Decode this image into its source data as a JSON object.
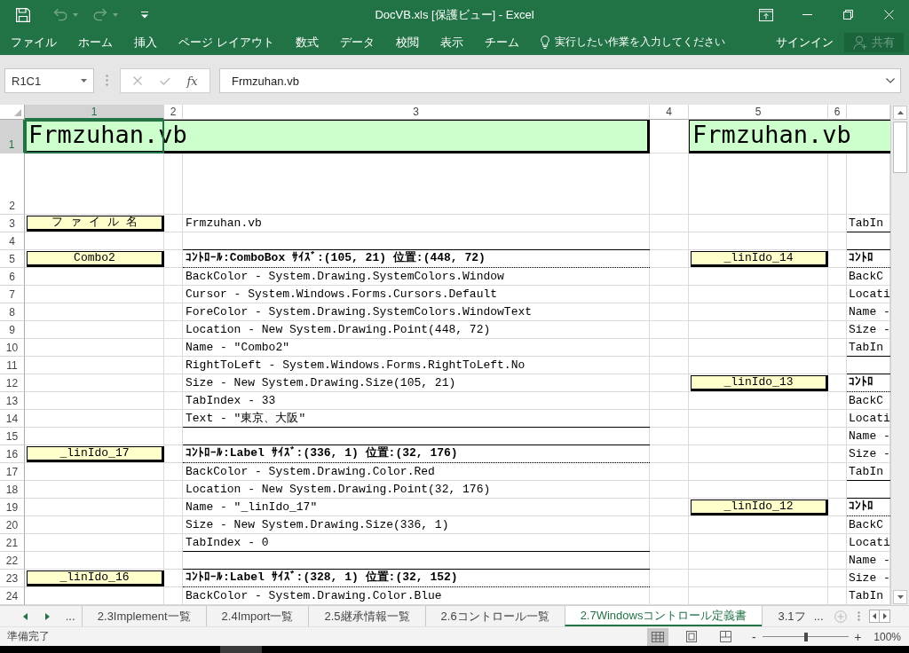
{
  "window": {
    "title": "DocVB.xls [保護ビュー] - Excel"
  },
  "quick_access": [
    {
      "kind": "save",
      "disabled": false
    },
    {
      "kind": "undo",
      "disabled": true
    },
    {
      "kind": "redo",
      "disabled": true
    },
    {
      "kind": "customize",
      "disabled": false
    }
  ],
  "ribbon": {
    "tabs": [
      "ファイル",
      "ホーム",
      "挿入",
      "ページ レイアウト",
      "数式",
      "データ",
      "校閲",
      "表示",
      "チーム"
    ],
    "tell_me": {
      "placeholder": "実行したい作業を入力してください"
    },
    "sign_in": "サインイン",
    "share": {
      "label": "共有",
      "disabled": true
    }
  },
  "formula_bar": {
    "name_box": "R1C1",
    "cancel": {
      "disabled": true
    },
    "enter": {
      "disabled": true
    },
    "function_label": "fx",
    "value": "Frmzuhan.vb"
  },
  "sheet": {
    "columns": [
      {
        "label": "1",
        "selected": true
      },
      {
        "label": "2",
        "selected": false
      },
      {
        "label": "3",
        "selected": false
      },
      {
        "label": "4",
        "selected": false
      },
      {
        "label": "5",
        "selected": false
      },
      {
        "label": "6",
        "selected": false
      }
    ],
    "rows": [
      {
        "number": "1",
        "selected": true,
        "kind": "title",
        "left_title": "Frmzuhan.vb",
        "right_title": "Frmzuhan.vb"
      },
      {
        "number": "2",
        "selected": false,
        "kind": "spacer"
      },
      {
        "number": "3",
        "selected": false,
        "kind": "entry",
        "left_label": "フ ァ イ ル 名",
        "main": {
          "text": "Frmzuhan.vb",
          "kind": "item"
        },
        "side": {
          "text": "TabIn",
          "kind": "last"
        }
      },
      {
        "number": "4",
        "selected": false,
        "kind": "entry"
      },
      {
        "number": "5",
        "selected": false,
        "kind": "entry",
        "left_label": "Combo2",
        "main": {
          "text": "ｺﾝﾄﾛｰﾙ:ComboBox ｻｲｽﾞ:(105, 21) 位置:(448, 72)",
          "kind": "header"
        },
        "right_label": "_linIdo_14",
        "side": {
          "text": "ｺﾝﾄﾛ",
          "kind": "header"
        }
      },
      {
        "number": "6",
        "selected": false,
        "kind": "entry",
        "main": {
          "text": "BackColor - System.Drawing.SystemColors.Window",
          "kind": "item"
        },
        "side": {
          "text": "BackC",
          "kind": "item"
        }
      },
      {
        "number": "7",
        "selected": false,
        "kind": "entry",
        "main": {
          "text": "Cursor - System.Windows.Forms.Cursors.Default",
          "kind": "item"
        },
        "side": {
          "text": "Locati",
          "kind": "item"
        }
      },
      {
        "number": "8",
        "selected": false,
        "kind": "entry",
        "main": {
          "text": "ForeColor - System.Drawing.SystemColors.WindowText",
          "kind": "item"
        },
        "side": {
          "text": "Name -",
          "kind": "item"
        }
      },
      {
        "number": "9",
        "selected": false,
        "kind": "entry",
        "main": {
          "text": "Location - New System.Drawing.Point(448, 72)",
          "kind": "item"
        },
        "side": {
          "text": "Size -",
          "kind": "item"
        }
      },
      {
        "number": "10",
        "selected": false,
        "kind": "entry",
        "main": {
          "text": "Name - \"Combo2\"",
          "kind": "item"
        },
        "side": {
          "text": "TabIn",
          "kind": "last"
        }
      },
      {
        "number": "11",
        "selected": false,
        "kind": "entry",
        "main": {
          "text": "RightToLeft - System.Windows.Forms.RightToLeft.No",
          "kind": "item"
        }
      },
      {
        "number": "12",
        "selected": false,
        "kind": "entry",
        "main": {
          "text": "Size - New System.Drawing.Size(105, 21)",
          "kind": "item"
        },
        "right_label": "_linIdo_13",
        "side": {
          "text": "ｺﾝﾄﾛ",
          "kind": "header"
        }
      },
      {
        "number": "13",
        "selected": false,
        "kind": "entry",
        "main": {
          "text": "TabIndex - 33",
          "kind": "item"
        },
        "side": {
          "text": "BackC",
          "kind": "item"
        }
      },
      {
        "number": "14",
        "selected": false,
        "kind": "entry",
        "main": {
          "text": "Text - \"東京、大阪\"",
          "kind": "last"
        },
        "side": {
          "text": "Locati",
          "kind": "item"
        }
      },
      {
        "number": "15",
        "selected": false,
        "kind": "entry",
        "side": {
          "text": "Name -",
          "kind": "item"
        }
      },
      {
        "number": "16",
        "selected": false,
        "kind": "entry",
        "left_label": "_linIdo_17",
        "main": {
          "text": "ｺﾝﾄﾛｰﾙ:Label ｻｲｽﾞ:(336, 1) 位置:(32, 176)",
          "kind": "header"
        },
        "side": {
          "text": "Size -",
          "kind": "item"
        }
      },
      {
        "number": "17",
        "selected": false,
        "kind": "entry",
        "main": {
          "text": "BackColor - System.Drawing.Color.Red",
          "kind": "item"
        },
        "side": {
          "text": "TabIn",
          "kind": "last"
        }
      },
      {
        "number": "18",
        "selected": false,
        "kind": "entry",
        "main": {
          "text": "Location - New System.Drawing.Point(32, 176)",
          "kind": "item"
        }
      },
      {
        "number": "19",
        "selected": false,
        "kind": "entry",
        "main": {
          "text": "Name - \"_linIdo_17\"",
          "kind": "item"
        },
        "right_label": "_linIdo_12",
        "side": {
          "text": "ｺﾝﾄﾛ",
          "kind": "header"
        }
      },
      {
        "number": "20",
        "selected": false,
        "kind": "entry",
        "main": {
          "text": "Size - New System.Drawing.Size(336, 1)",
          "kind": "item"
        },
        "side": {
          "text": "BackC",
          "kind": "item"
        }
      },
      {
        "number": "21",
        "selected": false,
        "kind": "entry",
        "main": {
          "text": "TabIndex - 0",
          "kind": "last"
        },
        "side": {
          "text": "Locati",
          "kind": "item"
        }
      },
      {
        "number": "22",
        "selected": false,
        "kind": "entry",
        "side": {
          "text": "Name -",
          "kind": "item"
        }
      },
      {
        "number": "23",
        "selected": false,
        "kind": "entry",
        "left_label": "_linIdo_16",
        "main": {
          "text": "ｺﾝﾄﾛｰﾙ:Label ｻｲｽﾞ:(328, 1) 位置:(32, 152)",
          "kind": "header"
        },
        "side": {
          "text": "Size -",
          "kind": "item"
        }
      },
      {
        "number": "24",
        "selected": false,
        "kind": "entry",
        "main": {
          "text": "BackColor - System.Drawing.Color.Blue",
          "kind": "item"
        },
        "side": {
          "text": "TabIn",
          "kind": "item"
        }
      }
    ]
  },
  "sheet_tabs": {
    "more_left": "...",
    "tabs": [
      {
        "label": "2.3Implement一覧",
        "selected": false
      },
      {
        "label": "2.4Import一覧",
        "selected": false
      },
      {
        "label": "2.5継承情報一覧",
        "selected": false
      },
      {
        "label": "2.6コントロール一覧",
        "selected": false
      },
      {
        "label": "2.7Windowsコントロール定義書",
        "selected": true
      },
      {
        "label": "3.1フ",
        "selected": false
      }
    ],
    "more_right": "..."
  },
  "status_bar": {
    "text": "準備完了",
    "views": [
      {
        "kind": "normal",
        "selected": true
      },
      {
        "kind": "page_layout",
        "selected": false
      },
      {
        "kind": "page_break",
        "selected": false
      }
    ],
    "zoom_out": "-",
    "zoom_in": "+",
    "zoom": {
      "level": 0.5,
      "label": "100%"
    }
  }
}
